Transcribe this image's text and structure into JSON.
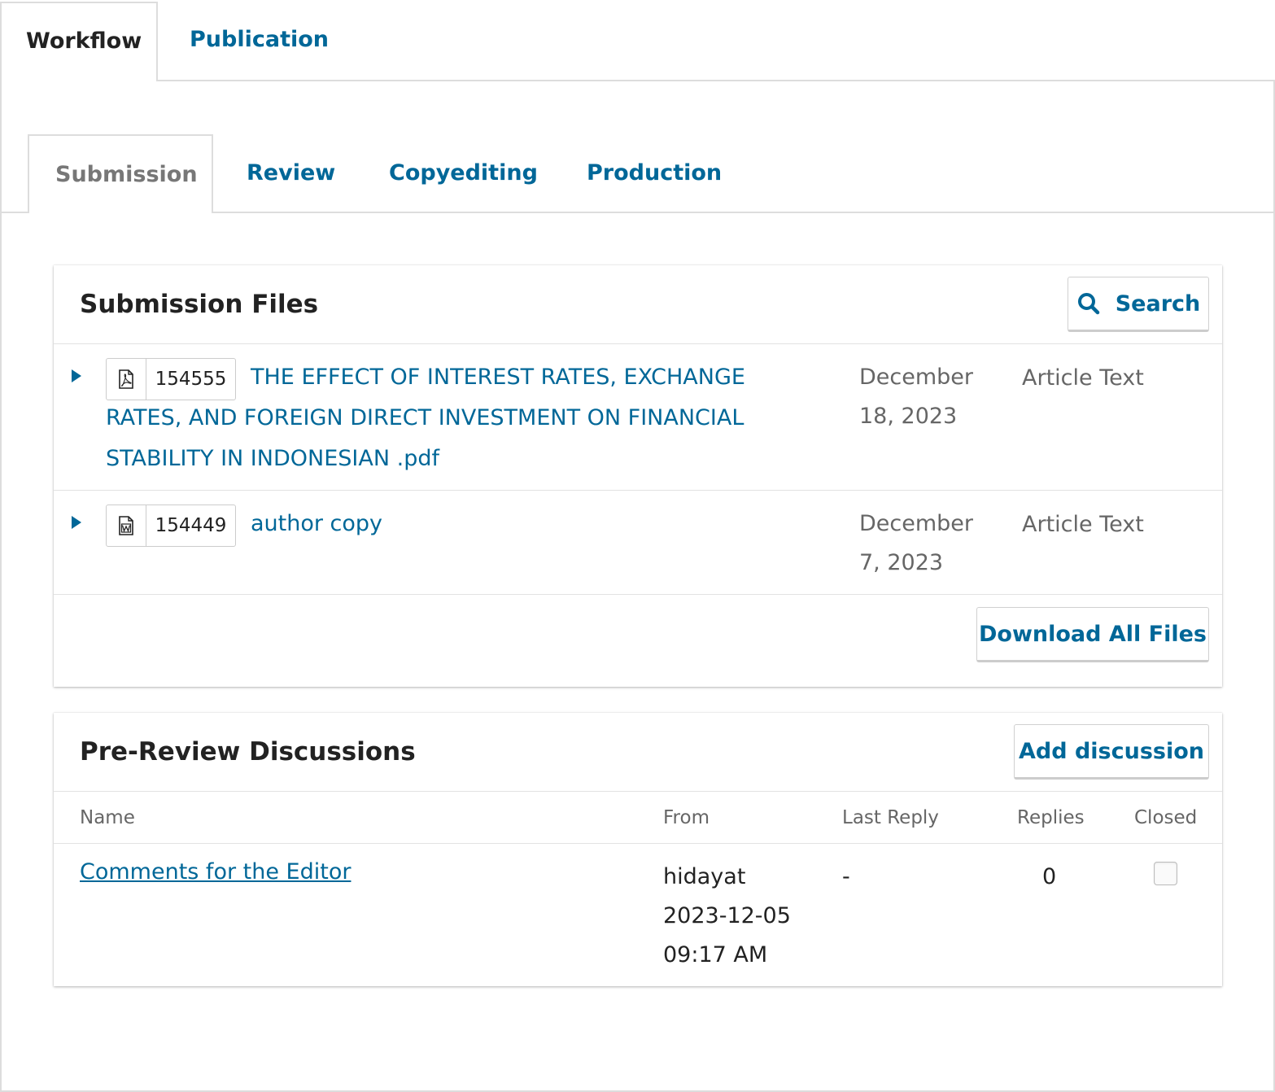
{
  "top_tabs": [
    {
      "label": "Workflow",
      "active": true
    },
    {
      "label": "Publication",
      "active": false
    }
  ],
  "stage_tabs": [
    {
      "label": "Submission",
      "active": true
    },
    {
      "label": "Review",
      "active": false
    },
    {
      "label": "Copyediting",
      "active": false
    },
    {
      "label": "Production",
      "active": false
    }
  ],
  "submission_files": {
    "title": "Submission Files",
    "search_label": "Search",
    "files": [
      {
        "icon": "pdf-file-icon",
        "id": "154555",
        "name": "THE EFFECT OF INTEREST RATES, EXCHANGE RATES, AND FOREIGN DIRECT INVESTMENT ON FINANCIAL STABILITY IN INDONESIAN .pdf",
        "date": "December 18, 2023",
        "type": "Article Text"
      },
      {
        "icon": "word-file-icon",
        "id": "154449",
        "name": "author copy",
        "date": "December 7, 2023",
        "type": "Article Text"
      }
    ],
    "download_all_label": "Download All Files"
  },
  "discussions": {
    "title": "Pre-Review Discussions",
    "add_label": "Add discussion",
    "columns": {
      "name": "Name",
      "from": "From",
      "last_reply": "Last Reply",
      "replies": "Replies",
      "closed": "Closed"
    },
    "rows": [
      {
        "name": "Comments for the Editor",
        "from": "hidayat 2023-12-05 09:17 AM",
        "last_reply": "-",
        "replies": "0",
        "closed": false
      }
    ]
  },
  "colors": {
    "link": "#006798",
    "border": "#dddddd",
    "muted": "#666666"
  }
}
